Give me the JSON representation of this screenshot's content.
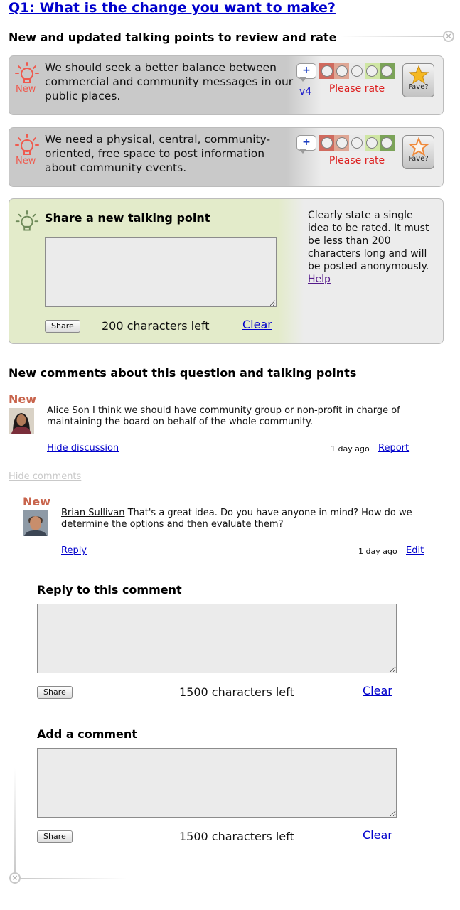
{
  "question": {
    "title": "Q1: What is the change you want to make?"
  },
  "talking_points": {
    "heading": "New and updated talking points to review and rate",
    "items": [
      {
        "new_label": "New",
        "text": "We should seek a better balance between commercial and community messages in our public places.",
        "plus": "+",
        "version": "v4",
        "rate_label": "Please rate",
        "fave_label": "Fave?"
      },
      {
        "new_label": "New",
        "text": "We need a physical, central, community-oriented, free space to post information about community events.",
        "plus": "+",
        "version": "",
        "rate_label": "Please rate",
        "fave_label": "Fave?"
      }
    ],
    "rating_colors": [
      "#d06a5e",
      "#dfa694",
      "#e9e9e9",
      "#cfe6a4",
      "#7ba358"
    ]
  },
  "share_point": {
    "heading": "Share a new talking point",
    "textarea_value": "",
    "share_button": "Share",
    "counter": "200 characters left",
    "clear": "Clear",
    "help_text": "Clearly state a single idea to be rated. It must be less than 200 characters long and will be posted anonymously.",
    "help_link": "Help"
  },
  "comments": {
    "heading": "New comments about this question and talking points",
    "hide_comments": "Hide comments",
    "items": [
      {
        "new_label": "New",
        "user": "Alice Son",
        "text": "I think we should have community group or non-profit in charge of maintaining the board on behalf of the whole community.",
        "action_left": "Hide discussion",
        "time": "1 day ago",
        "action_right": "Report"
      },
      {
        "new_label": "New",
        "user": "Brian Sullivan",
        "text": "That's a great idea. Do you have anyone in mind? How do we determine the options and then evaluate them?",
        "action_left": "Reply",
        "time": "1 day ago",
        "action_right": "Edit"
      }
    ]
  },
  "reply_form": {
    "heading": "Reply to this comment",
    "textarea_value": "",
    "share_button": "Share",
    "counter": "1500 characters left",
    "clear": "Clear"
  },
  "add_comment_form": {
    "heading": "Add a comment",
    "textarea_value": "",
    "share_button": "Share",
    "counter": "1500 characters left",
    "clear": "Clear"
  },
  "icons": {
    "close": "×",
    "bulb_new": "lightbulb-icon",
    "bulb_share": "lightbulb-icon",
    "star": "star-icon"
  }
}
